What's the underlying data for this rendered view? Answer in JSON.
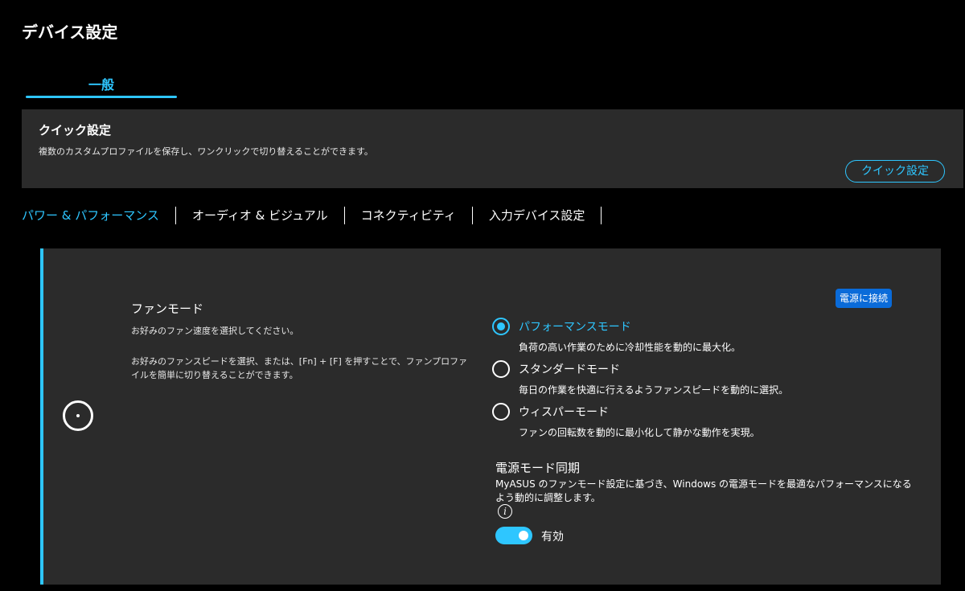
{
  "page": {
    "title": "デバイス設定"
  },
  "tabs": [
    {
      "label": "一般",
      "active": true
    }
  ],
  "quick_settings": {
    "title": "クイック設定",
    "description": "複数のカスタムプロファイルを保存し、ワンクリックで切り替えることができます。",
    "button_label": "クイック設定"
  },
  "subtabs": [
    {
      "label": "パワー & パフォーマンス",
      "active": true
    },
    {
      "label": "オーディオ & ビジュアル",
      "active": false
    },
    {
      "label": "コネクティビティ",
      "active": false
    },
    {
      "label": "入力デバイス設定",
      "active": false
    }
  ],
  "fan_mode": {
    "icon": "fan-icon",
    "title": "ファンモード",
    "subtitle": "お好みのファン速度を選択してください。",
    "hint": "お好みのファンスピードを選択、または、[Fn] + [F] を押すことで、ファンプロファイルを簡単に切り替えることができます。",
    "power_badge": "電源に接続",
    "options": [
      {
        "label": "パフォーマンスモード",
        "description": "負荷の高い作業のために冷却性能を動的に最大化。",
        "selected": true
      },
      {
        "label": "スタンダードモード",
        "description": "毎日の作業を快適に行えるようファンスピードを動的に選択。",
        "selected": false
      },
      {
        "label": "ウィスパーモード",
        "description": "ファンの回転数を動的に最小化して静かな動作を実現。",
        "selected": false
      }
    ]
  },
  "power_sync": {
    "title": "電源モード同期",
    "description": "MyASUS のファンモード設定に基づき、Windows の電源モードを最適なパフォーマンスになるよう動的に調整します。",
    "info_icon": "info-icon",
    "toggle_on": true,
    "toggle_label": "有効"
  },
  "colors": {
    "accent": "#2ec6ff",
    "badge": "#0a6bd9",
    "card_bg": "#2b2b2b",
    "page_bg": "#000000"
  }
}
